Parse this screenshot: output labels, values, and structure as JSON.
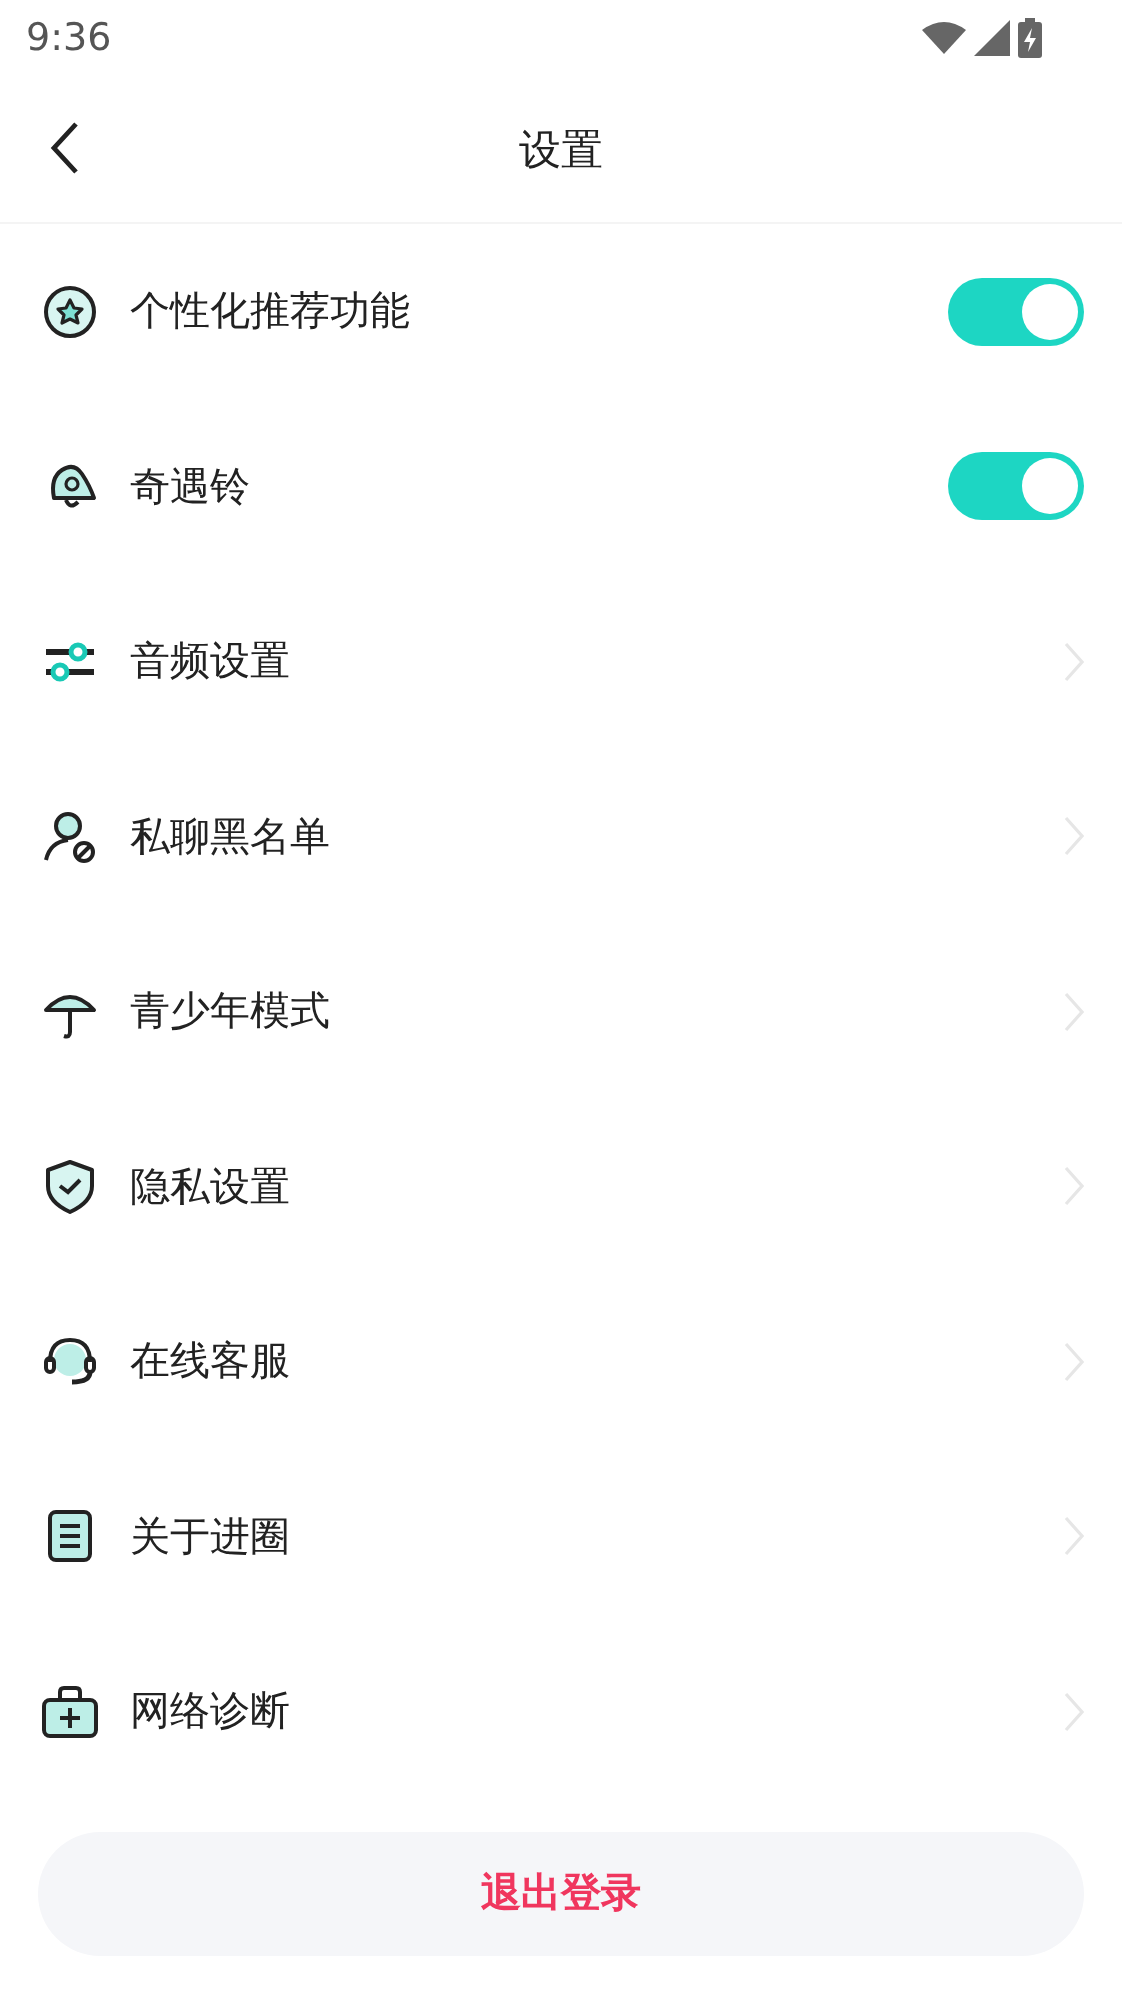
{
  "status_bar": {
    "time": "9:36"
  },
  "header": {
    "title": "设置"
  },
  "items": [
    {
      "kind": "toggle",
      "label": "个性化推荐功能",
      "on": true
    },
    {
      "kind": "toggle",
      "label": "奇遇铃",
      "on": true
    },
    {
      "kind": "link",
      "label": "音频设置"
    },
    {
      "kind": "link",
      "label": "私聊黑名单"
    },
    {
      "kind": "link",
      "label": "青少年模式"
    },
    {
      "kind": "link",
      "label": "隐私设置"
    },
    {
      "kind": "link",
      "label": "在线客服"
    },
    {
      "kind": "link",
      "label": "关于进圈"
    },
    {
      "kind": "link",
      "label": "网络诊断"
    }
  ],
  "logout_button": "退出登录"
}
